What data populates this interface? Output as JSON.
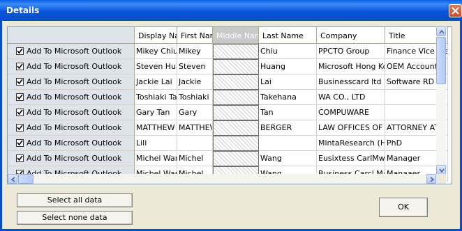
{
  "window": {
    "title": "Details"
  },
  "grid": {
    "columns": [
      "Display Nam",
      "First Name",
      "Middle Name",
      "Last Name",
      "Company",
      "Title"
    ],
    "rows": [
      {
        "action": "Add To Microsoft Outlook",
        "display": "Mikey Chiu",
        "first": "Mikey",
        "last": "Chiu",
        "company": "PPCTO Group",
        "title": "Finance Vice Pre"
      },
      {
        "action": "Add To Microsoft Outlook",
        "display": "Steven Huar",
        "first": "Steven",
        "last": "Huang",
        "company": "Microsoft Hong Kong",
        "title": "OEM Account M"
      },
      {
        "action": "Add To Microsoft Outlook",
        "display": "Jackie Lai",
        "first": "Jackie",
        "last": "Lai",
        "company": "Businesscard ltd",
        "title": "Software RD En"
      },
      {
        "action": "Add To Microsoft Outlook",
        "display": "Toshiaki Tak",
        "first": "Toshiaki",
        "last": "Takehana",
        "company": "WA CO., LTD",
        "title": ""
      },
      {
        "action": "Add To Microsoft Outlook",
        "display": "Gary Tan",
        "first": "Gary",
        "last": "Tan",
        "company": "COMPUWARE",
        "title": ""
      },
      {
        "action": "Add To Microsoft Outlook",
        "display": "MATTHEW I",
        "first": "MATTHEV",
        "last": "BERGER",
        "company": "LAW OFFICES OF AI",
        "title": "ATTORNEY AT"
      },
      {
        "action": "Add To Microsoft Outlook",
        "display": "Lili",
        "first": "",
        "last": "",
        "company": "MintaResearch (HK)",
        "title": "PhD"
      },
      {
        "action": "Add To Microsoft Outlook",
        "display": "Michel Wang",
        "first": "Michel",
        "last": "Wang",
        "company": "Eusixtess CarlMwmge",
        "title": "Manager"
      },
      {
        "action": "Add To Microsoft Outlook",
        "display": "Michel Wang",
        "first": "Michel",
        "last": "Wang",
        "company": "Business Carcl Mana",
        "title": "Manaaer"
      }
    ]
  },
  "buttons": {
    "select_all": "Select all data",
    "select_none": "Select none data",
    "ok": "OK"
  },
  "icons": [
    "close-icon",
    "checkmark-icon",
    "scroll-up-icon",
    "scroll-down-icon",
    "scroll-left-icon",
    "scroll-right-icon"
  ],
  "colors": {
    "titlebar": "#0a55dc",
    "close": "#c94a23",
    "grid_border": "#7f9db9"
  }
}
